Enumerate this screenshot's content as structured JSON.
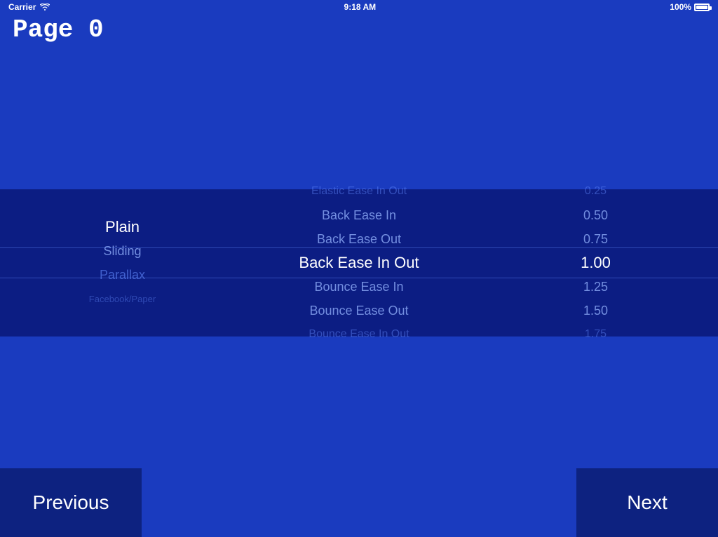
{
  "statusBar": {
    "carrier": "Carrier",
    "time": "9:18 AM",
    "battery": "100%"
  },
  "pageTitle": "Page 0",
  "picker": {
    "leftColumn": [
      {
        "label": "Plain",
        "state": "selected"
      },
      {
        "label": "Sliding",
        "state": "semi"
      },
      {
        "label": "Parallax",
        "state": "dim"
      },
      {
        "label": "Facebook/Paper",
        "state": "dim"
      }
    ],
    "centerColumn": [
      {
        "label": "Elastic Ease In Out",
        "state": "dim"
      },
      {
        "label": "Back Ease In",
        "state": "semi"
      },
      {
        "label": "Back Ease Out",
        "state": "semi"
      },
      {
        "label": "Back Ease In Out",
        "state": "selected"
      },
      {
        "label": "Bounce Ease In",
        "state": "semi"
      },
      {
        "label": "Bounce Ease Out",
        "state": "semi"
      },
      {
        "label": "Bounce Ease In Out",
        "state": "dim"
      }
    ],
    "rightColumn": [
      {
        "label": "0.25",
        "state": "dim"
      },
      {
        "label": "0.50",
        "state": "semi"
      },
      {
        "label": "0.75",
        "state": "semi"
      },
      {
        "label": "1.00",
        "state": "selected"
      },
      {
        "label": "1.25",
        "state": "semi"
      },
      {
        "label": "1.50",
        "state": "semi"
      },
      {
        "label": "1.75",
        "state": "dim"
      }
    ]
  },
  "navigation": {
    "previousLabel": "Previous",
    "nextLabel": "Next"
  }
}
